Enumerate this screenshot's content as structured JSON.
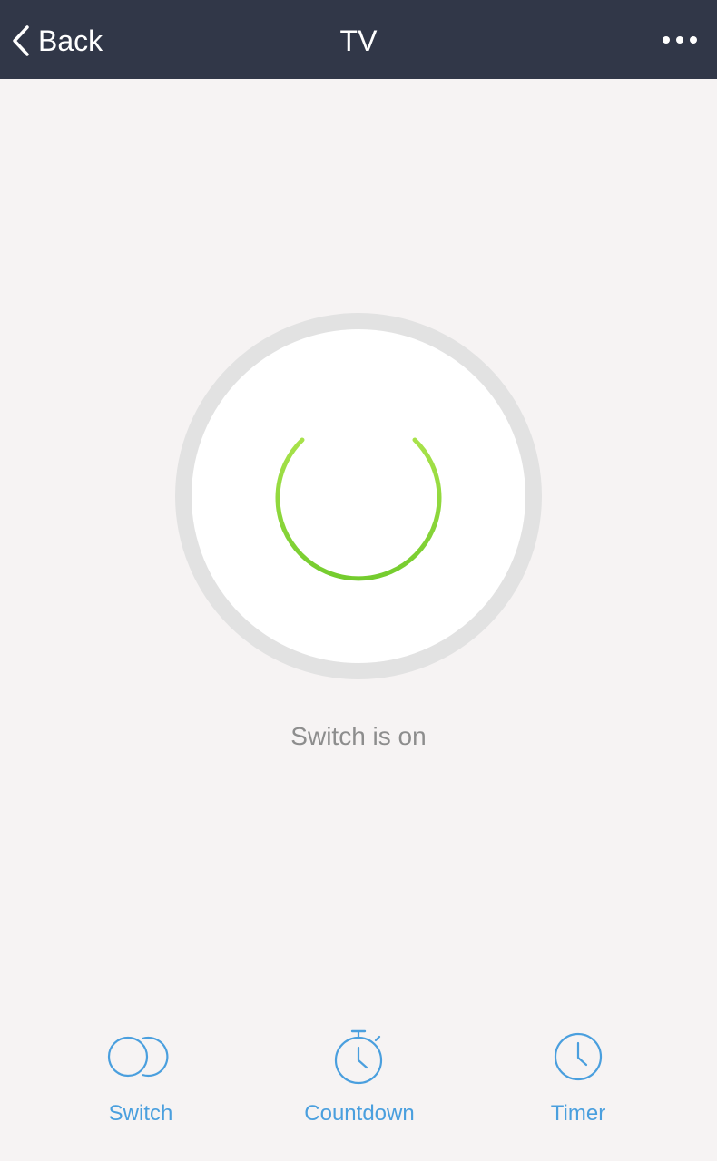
{
  "navbar": {
    "back_label": "Back",
    "title": "TV",
    "more_icon": "more-dots-icon",
    "background_color": "#313748"
  },
  "power": {
    "icon": "power-icon",
    "state": "on",
    "status_text": "Switch is on",
    "icon_color": "#8ed63a"
  },
  "tabs": [
    {
      "label": "Switch",
      "icon": "switch-toggle-icon"
    },
    {
      "label": "Countdown",
      "icon": "stopwatch-icon"
    },
    {
      "label": "Timer",
      "icon": "clock-icon"
    }
  ],
  "colors": {
    "accent": "#4a9fde",
    "background": "#f6f3f3"
  }
}
